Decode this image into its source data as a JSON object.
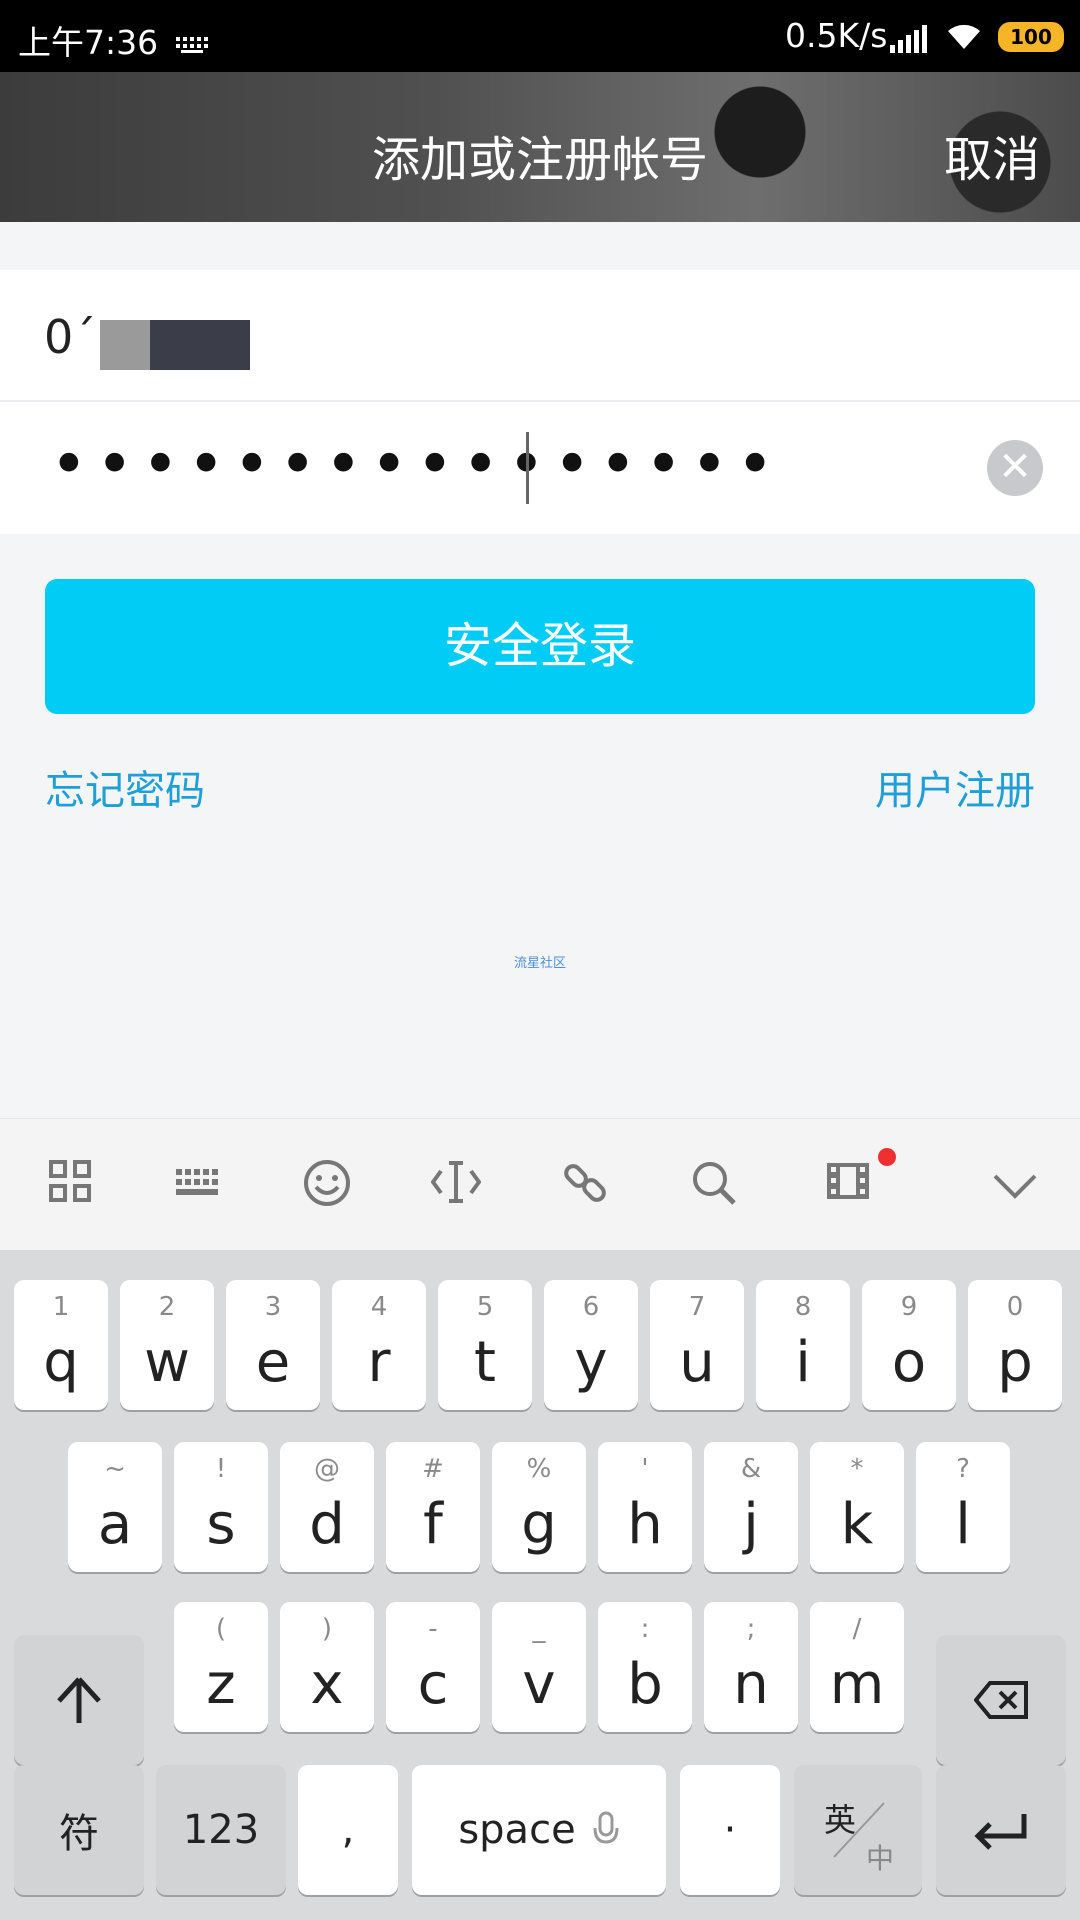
{
  "status_bar": {
    "time": "上午7:36",
    "network_speed": "0.5K/s",
    "battery": "100"
  },
  "header": {
    "title": "添加或注册帐号",
    "cancel": "取消"
  },
  "form": {
    "account_value": "0´",
    "password_mask": "••••••••••••••••"
  },
  "login_button": "安全登录",
  "links": {
    "forgot": "忘记密码",
    "register": "用户注册",
    "community": "流星社区"
  },
  "keyboard": {
    "row1": [
      {
        "hint": "1",
        "key": "q"
      },
      {
        "hint": "2",
        "key": "w"
      },
      {
        "hint": "3",
        "key": "e"
      },
      {
        "hint": "4",
        "key": "r"
      },
      {
        "hint": "5",
        "key": "t"
      },
      {
        "hint": "6",
        "key": "y"
      },
      {
        "hint": "7",
        "key": "u"
      },
      {
        "hint": "8",
        "key": "i"
      },
      {
        "hint": "9",
        "key": "o"
      },
      {
        "hint": "0",
        "key": "p"
      }
    ],
    "row2": [
      {
        "hint": "~",
        "key": "a"
      },
      {
        "hint": "!",
        "key": "s"
      },
      {
        "hint": "@",
        "key": "d"
      },
      {
        "hint": "#",
        "key": "f"
      },
      {
        "hint": "%",
        "key": "g"
      },
      {
        "hint": "'",
        "key": "h"
      },
      {
        "hint": "&",
        "key": "j"
      },
      {
        "hint": "*",
        "key": "k"
      },
      {
        "hint": "?",
        "key": "l"
      }
    ],
    "row3": [
      {
        "hint": "(",
        "key": "z"
      },
      {
        "hint": ")",
        "key": "x"
      },
      {
        "hint": "-",
        "key": "c"
      },
      {
        "hint": "_",
        "key": "v"
      },
      {
        "hint": ":",
        "key": "b"
      },
      {
        "hint": ";",
        "key": "n"
      },
      {
        "hint": "/",
        "key": "m"
      }
    ],
    "symbols": "符",
    "numbers": "123",
    "comma": ",",
    "space": "space",
    "period": "·",
    "lang_top": "英",
    "lang_bottom": "中"
  },
  "toolbar_icons": [
    "apps-grid-icon",
    "keyboard-icon",
    "emoji-icon",
    "cursor-icon",
    "link-icon",
    "search-icon",
    "video-icon",
    "collapse-icon"
  ],
  "colors": {
    "accent": "#00ccf5",
    "link": "#1f9fd6"
  }
}
